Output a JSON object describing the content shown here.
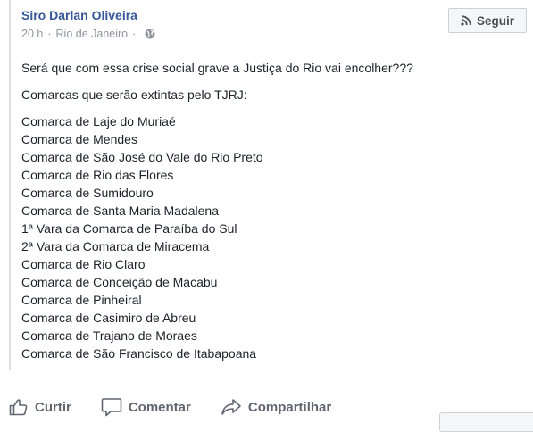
{
  "post": {
    "author": "Siro Darlan Oliveira",
    "time": "20 h",
    "location": "Rio de Janeiro",
    "separator": "·",
    "privacy_icon": "globe-icon",
    "follow_label": "Seguir",
    "follow_icon": "rss-icon",
    "paragraph1": "Será que com essa crise social grave a Justiça do Rio vai encolher???",
    "paragraph2": "Comarcas que serão extintas pelo TJRJ:",
    "list": [
      "Comarca de Laje do Muriaé",
      "Comarca de Mendes",
      "Comarca de São José do Vale do Rio Preto",
      "Comarca de Rio das Flores",
      "Comarca de Sumidouro",
      "Comarca de Santa Maria Madalena",
      "1ª Vara da Comarca de Paraíba do Sul",
      "2ª Vara da Comarca de Miracema",
      "Comarca de Rio Claro",
      "Comarca de Conceição de Macabu",
      "Comarca de Pinheiral",
      "Comarca de Casimiro de Abreu",
      "Comarca de Trajano de Moraes",
      "Comarca de São Francisco de Itabapoana"
    ]
  },
  "actions": {
    "like_label": "Curtir",
    "comment_label": "Comentar",
    "share_label": "Compartilhar"
  },
  "colors": {
    "author_link": "#365899",
    "meta_text": "#90949c",
    "body_text": "#1d2129",
    "action_text": "#616770"
  }
}
